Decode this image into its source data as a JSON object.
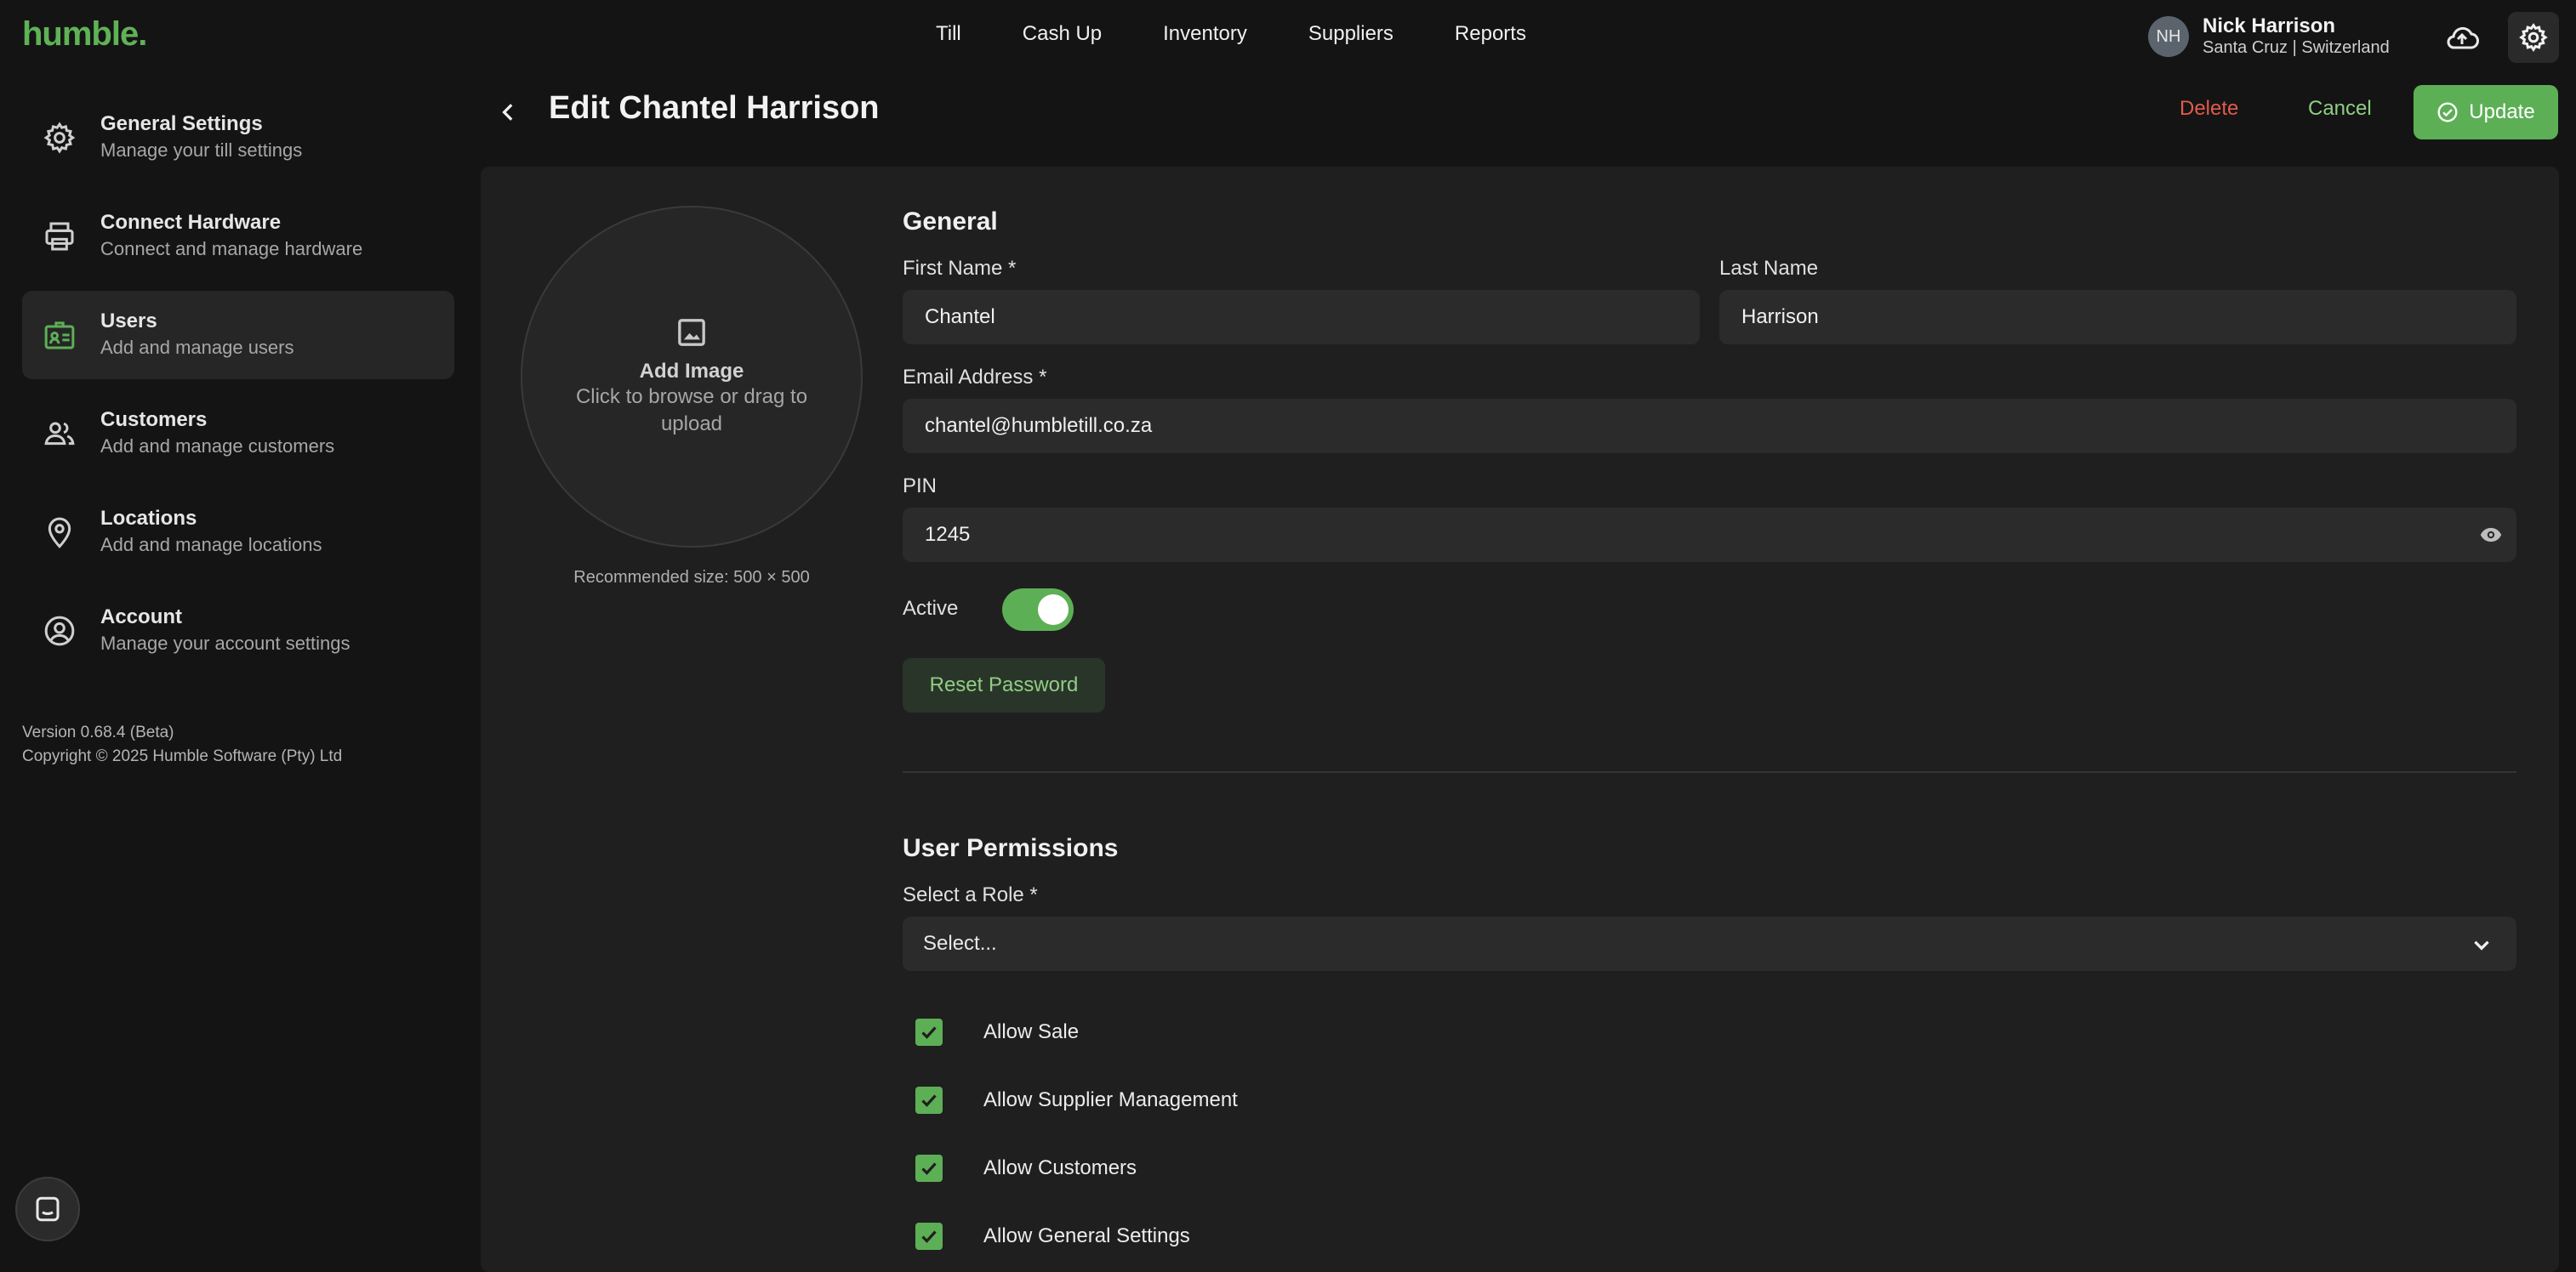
{
  "app": {
    "logo": "humble."
  },
  "nav": {
    "items": [
      "Till",
      "Cash Up",
      "Inventory",
      "Suppliers",
      "Reports"
    ]
  },
  "user": {
    "initials": "NH",
    "name": "Nick Harrison",
    "location": "Santa Cruz | Switzerland"
  },
  "sidebar": {
    "items": [
      {
        "title": "General Settings",
        "subtitle": "Manage your till settings",
        "icon": "gear-icon"
      },
      {
        "title": "Connect Hardware",
        "subtitle": "Connect and manage hardware",
        "icon": "printer-icon"
      },
      {
        "title": "Users",
        "subtitle": "Add and manage users",
        "icon": "id-card-icon",
        "active": true
      },
      {
        "title": "Customers",
        "subtitle": "Add and manage customers",
        "icon": "people-icon"
      },
      {
        "title": "Locations",
        "subtitle": "Add and manage locations",
        "icon": "map-pin-icon"
      },
      {
        "title": "Account",
        "subtitle": "Manage your account settings",
        "icon": "account-circle-icon"
      }
    ],
    "version": "Version 0.68.4 (Beta)",
    "copyright": "Copyright © 2025 Humble Software (Pty) Ltd"
  },
  "header": {
    "title": "Edit Chantel Harrison",
    "delete_label": "Delete",
    "cancel_label": "Cancel",
    "update_label": "Update"
  },
  "image_upload": {
    "title": "Add Image",
    "hint": "Click to browse or drag to upload",
    "recommended": "Recommended size: 500 × 500"
  },
  "general": {
    "title": "General",
    "first_name_label": "First Name *",
    "first_name_value": "Chantel",
    "last_name_label": "Last Name",
    "last_name_value": "Harrison",
    "email_label": "Email Address *",
    "email_value": "chantel@humbletill.co.za",
    "pin_label": "PIN",
    "pin_value": "1245",
    "active_label": "Active",
    "active": true,
    "reset_password_label": "Reset Password"
  },
  "permissions": {
    "title": "User Permissions",
    "role_label": "Select a Role *",
    "role_value": "Select...",
    "items": [
      {
        "label": "Allow Sale",
        "checked": true
      },
      {
        "label": "Allow Supplier Management",
        "checked": true
      },
      {
        "label": "Allow Customers",
        "checked": true
      },
      {
        "label": "Allow General Settings",
        "checked": true
      }
    ]
  },
  "colors": {
    "accent": "#5daf55",
    "danger": "#e25b4d",
    "background": "#141414",
    "panel": "#1f1f1f"
  }
}
